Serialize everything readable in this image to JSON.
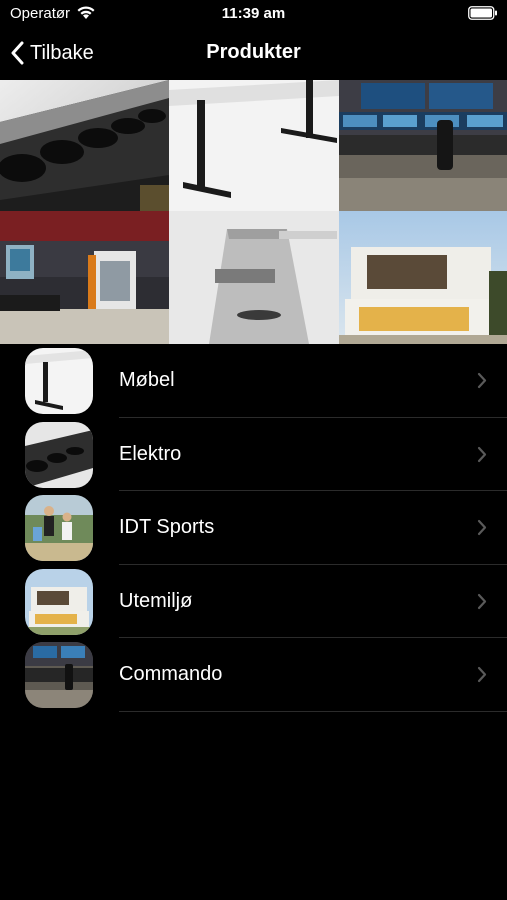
{
  "status_bar": {
    "carrier": "Operatør",
    "time": "11:39 am",
    "icons": [
      "wifi-icon",
      "battery-icon"
    ]
  },
  "nav": {
    "back_label": "Tilbake",
    "title": "Produkter",
    "back_icon": "chevron-left-icon"
  },
  "hero_images": [
    {
      "name": "power-strip-photo"
    },
    {
      "name": "desk-frame-photo"
    },
    {
      "name": "control-room-photo"
    },
    {
      "name": "workshop-photo"
    },
    {
      "name": "desk-profile-photo"
    },
    {
      "name": "modern-house-photo"
    }
  ],
  "products": [
    {
      "label": "Møbel",
      "thumb": "desk-frame-thumb"
    },
    {
      "label": "Elektro",
      "thumb": "power-strip-thumb"
    },
    {
      "label": "IDT Sports",
      "thumb": "sports-team-thumb"
    },
    {
      "label": "Utemiljø",
      "thumb": "house-thumb"
    },
    {
      "label": "Commando",
      "thumb": "control-room-thumb"
    }
  ],
  "colors": {
    "background": "#000000",
    "text": "#ffffff",
    "divider": "#2b2b2b",
    "chevron": "#5a5a5a"
  }
}
